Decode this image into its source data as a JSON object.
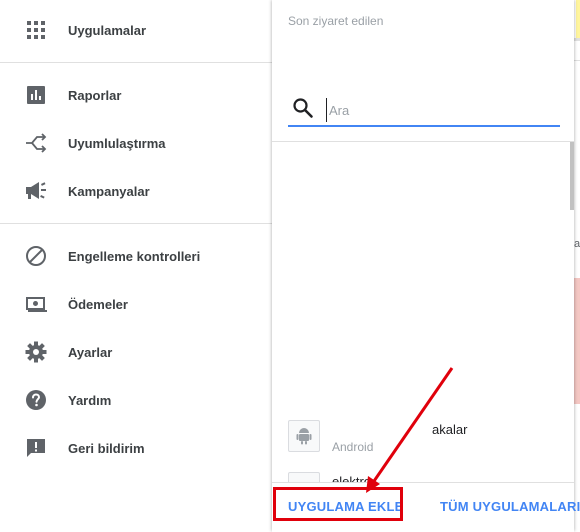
{
  "sidebar": {
    "items": [
      {
        "label": "Uygulamalar",
        "icon": "apps-grid-icon"
      },
      {
        "label": "Raporlar",
        "icon": "bar-chart-icon"
      },
      {
        "label": "Uyumlulaştırma",
        "icon": "mediation-icon"
      },
      {
        "label": "Kampanyalar",
        "icon": "megaphone-icon"
      },
      {
        "label": "Engelleme kontrolleri",
        "icon": "block-icon"
      },
      {
        "label": "Ödemeler",
        "icon": "payments-icon"
      },
      {
        "label": "Ayarlar",
        "icon": "gear-icon"
      },
      {
        "label": "Yardım",
        "icon": "help-icon"
      },
      {
        "label": "Geri bildirim",
        "icon": "feedback-icon"
      }
    ]
  },
  "panel": {
    "heading": "Son ziyaret edilen",
    "search": {
      "placeholder": "Ara",
      "value": ""
    },
    "apps": [
      {
        "name": "akalar",
        "platform": "Android",
        "icon": "android-icon"
      },
      {
        "name": "elektro",
        "platform": "",
        "icon": "android-icon"
      }
    ],
    "footer": {
      "add_app": "UYGULAMA EKLE",
      "all_apps": "TÜM UYGULAMALARI"
    }
  },
  "background": {
    "text_fragment": "a"
  },
  "colors": {
    "accent": "#4285f4",
    "highlight": "#e0000b",
    "icon": "#5f6368"
  }
}
